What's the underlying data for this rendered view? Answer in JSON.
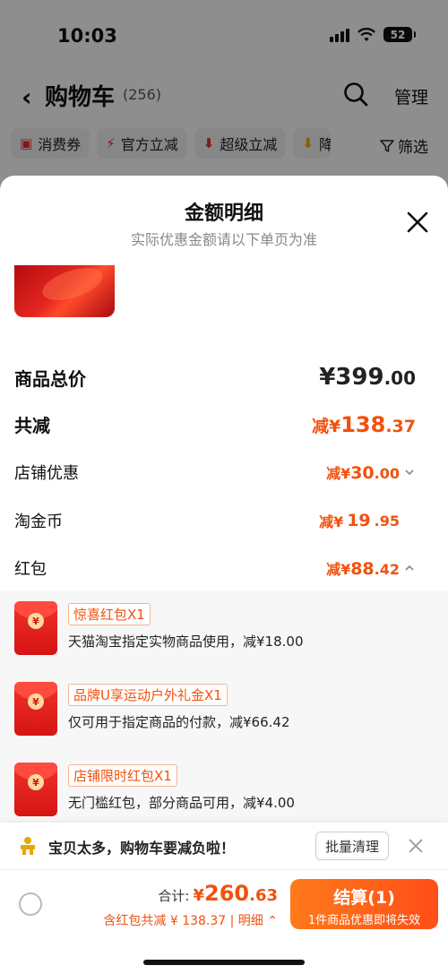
{
  "status_bar": {
    "time": "10:03",
    "battery": "52"
  },
  "header": {
    "title": "购物车",
    "count": "(256)",
    "manage": "管理"
  },
  "chips": [
    "消费券",
    "官方立减",
    "超级立减",
    "降"
  ],
  "filter": "筛选",
  "sheet": {
    "title": "金额明细",
    "subtitle": "实际优惠金额请以下单页为准",
    "rows": {
      "total_price": {
        "label": "商品总价",
        "currency": "¥",
        "int": "399",
        "dec": ".00"
      },
      "total_reduce": {
        "label": "共减",
        "prefix": "减¥",
        "int": "138",
        "dec": ".37"
      },
      "store_discount": {
        "label": "店铺优惠",
        "prefix": "减¥",
        "int": "30",
        "dec": ".00"
      },
      "taojinbi": {
        "label": "淘金币",
        "prefix": "减¥",
        "int": "19",
        "dec": ".95"
      },
      "hongbao": {
        "label": "红包",
        "prefix": "减¥",
        "int": "88",
        "dec": ".42"
      }
    },
    "red_packets": [
      {
        "tag": "惊喜红包X1",
        "desc": "天猫淘宝指定实物商品使用，减¥18.00"
      },
      {
        "tag": "品牌U享运动户外礼金X1",
        "desc": "仅可用于指定商品的付款，减¥66.42"
      },
      {
        "tag": "店铺限时红包X1",
        "desc": "无门槛红包，部分商品可用，减¥4.00"
      }
    ]
  },
  "banner": {
    "text": "宝贝太多，购物车要减负啦！",
    "button": "批量清理"
  },
  "footer": {
    "total_label": "合计:",
    "total_currency": "¥",
    "total_int": "260",
    "total_dec": ".63",
    "subtotal": "含红包共减 ¥ 138.37 | 明细",
    "checkout": "结算(1)",
    "checkout_sub": "1件商品优惠即将失效"
  },
  "colors": {
    "accent": "#f2510d",
    "checkout_start": "#ff7a1a",
    "checkout_end": "#ff4e18",
    "red_packet": "#e3262b"
  }
}
